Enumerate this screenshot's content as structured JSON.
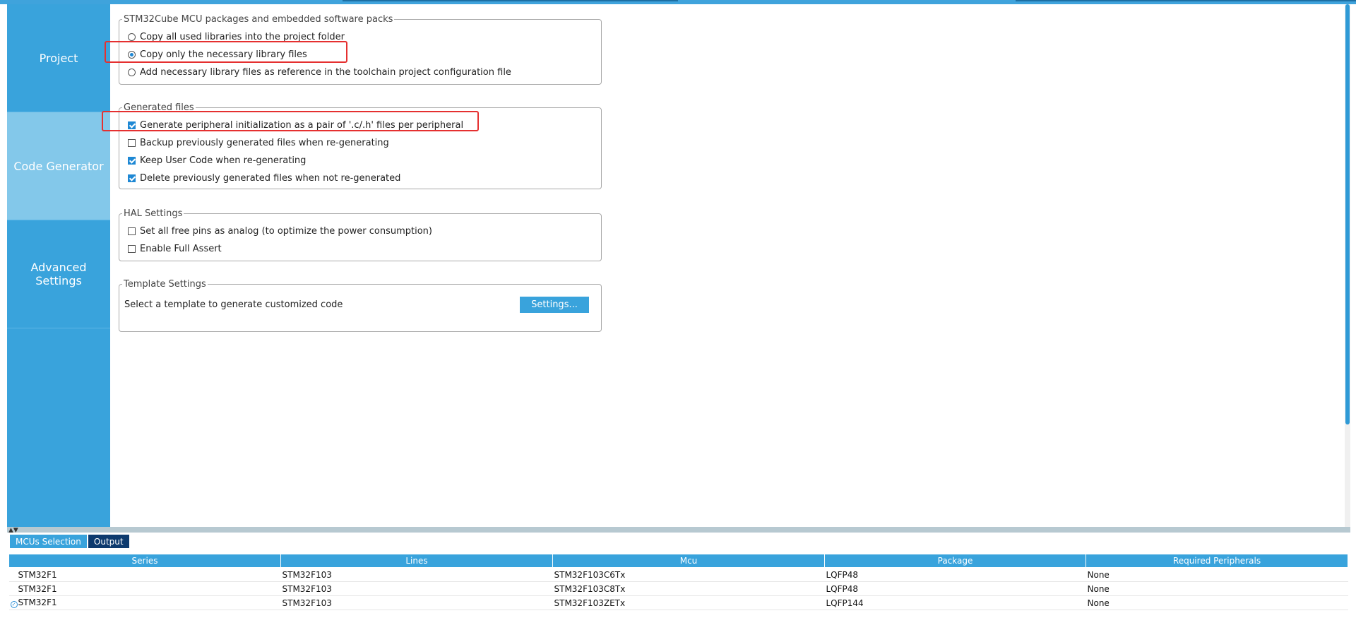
{
  "sidebar": {
    "items": [
      {
        "label": "Project"
      },
      {
        "label": "Code Generator"
      },
      {
        "label": "Advanced Settings"
      }
    ]
  },
  "groups": {
    "packages": {
      "title": "STM32Cube MCU packages and embedded software packs",
      "options": [
        {
          "label": "Copy all used libraries into the project folder",
          "selected": false
        },
        {
          "label": "Copy only the necessary library files",
          "selected": true
        },
        {
          "label": "Add necessary library files as reference in the toolchain project configuration file",
          "selected": false
        }
      ]
    },
    "generated": {
      "title": "Generated files",
      "options": [
        {
          "label": "Generate peripheral initialization as a pair of '.c/.h' files per peripheral",
          "checked": true
        },
        {
          "label": "Backup previously generated files when re-generating",
          "checked": false
        },
        {
          "label": "Keep User Code when re-generating",
          "checked": true
        },
        {
          "label": "Delete previously generated files when not re-generated",
          "checked": true
        }
      ]
    },
    "hal": {
      "title": "HAL Settings",
      "options": [
        {
          "label": "Set all free pins as analog (to optimize the power consumption)",
          "checked": false
        },
        {
          "label": "Enable Full Assert",
          "checked": false
        }
      ]
    },
    "template": {
      "title": "Template Settings",
      "description": "Select a template to generate customized code",
      "button_label": "Settings..."
    }
  },
  "bottom": {
    "tabs": [
      {
        "label": "MCUs Selection"
      },
      {
        "label": "Output"
      }
    ],
    "columns": [
      "Series",
      "Lines",
      "Mcu",
      "Package",
      "Required Peripherals"
    ],
    "rows": [
      [
        "STM32F1",
        "STM32F103",
        "STM32F103C6Tx",
        "LQFP48",
        "None"
      ],
      [
        "STM32F1",
        "STM32F103",
        "STM32F103C8Tx",
        "LQFP48",
        "None"
      ],
      [
        "STM32F1",
        "STM32F103",
        "STM32F103ZETx",
        "LQFP144",
        "None"
      ]
    ]
  },
  "colors": {
    "accent": "#39a3dc",
    "sidebar_active": "#83c8ea",
    "highlight": "#e53030",
    "output_tab": "#0d3a6e"
  }
}
